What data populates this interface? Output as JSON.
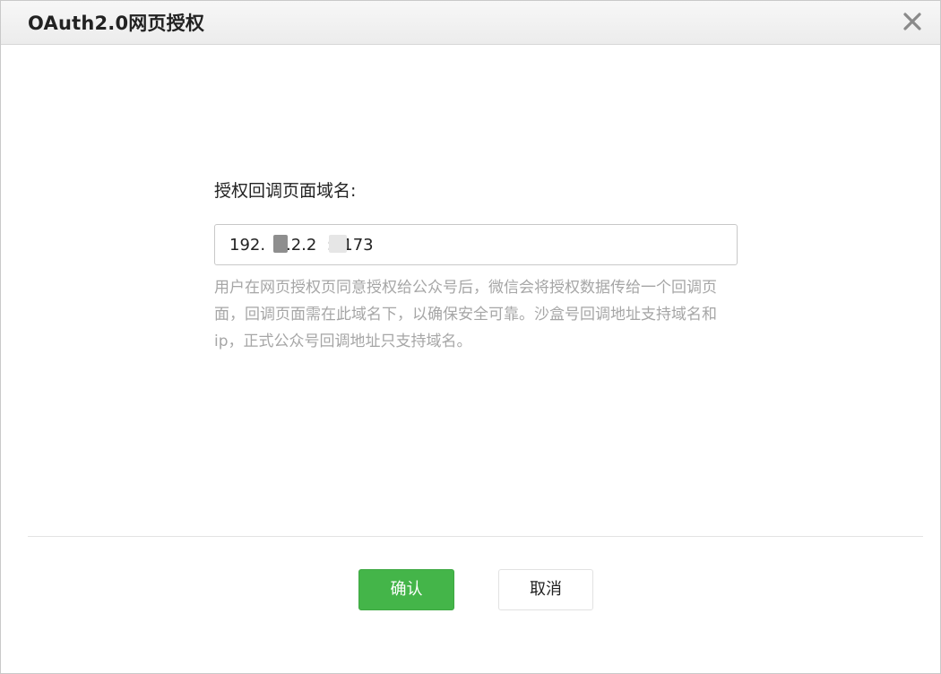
{
  "dialog": {
    "title": "OAuth2.0网页授权",
    "close_icon": "close-icon"
  },
  "form": {
    "label": "授权回调页面域名:",
    "input_value": "192.  8.2.2  :5173",
    "tip": "用户在网页授权页同意授权给公众号后，微信会将授权数据传给一个回调页面，回调页面需在此域名下，以确保安全可靠。沙盒号回调地址支持域名和ip，正式公众号回调地址只支持域名。"
  },
  "footer": {
    "confirm_label": "确认",
    "cancel_label": "取消"
  },
  "colors": {
    "primary": "#44b549",
    "tip_text": "#a6a6a6"
  }
}
